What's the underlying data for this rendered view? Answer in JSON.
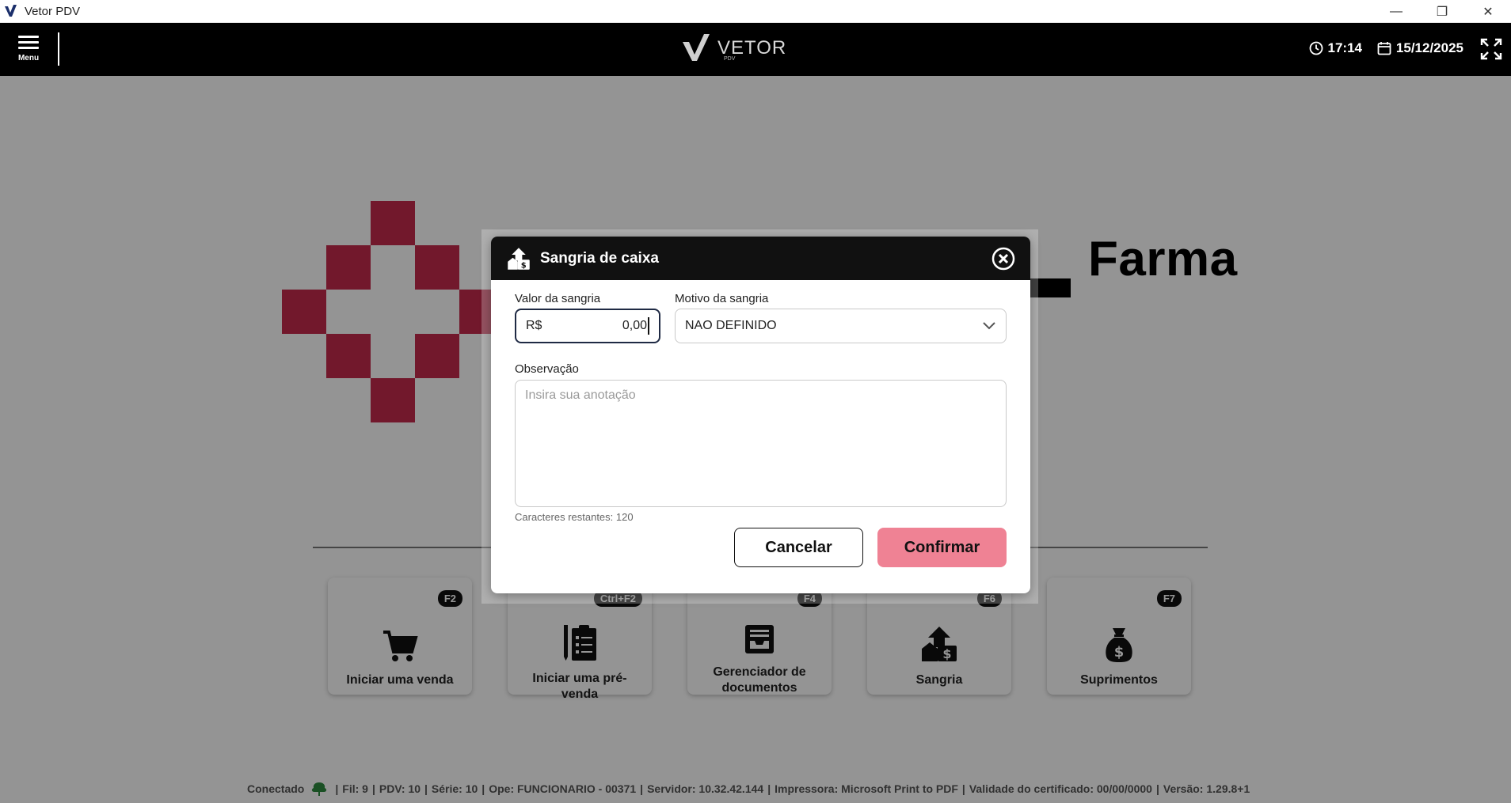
{
  "window": {
    "title": "Vetor PDV",
    "minimize_label": "—",
    "restore_label": "❐",
    "close_label": "✕"
  },
  "header": {
    "menu_label": "Menu",
    "brand_name": "VETOR",
    "brand_sub": "PDV",
    "time": "17:14",
    "date": "15/12/2025"
  },
  "background": {
    "brand_text": "Farma",
    "brand_color": "#c42a4d"
  },
  "cards": [
    {
      "label": "Iniciar uma venda",
      "shortcut": "F2",
      "icon": "cart-icon"
    },
    {
      "label": "Iniciar uma pré-venda",
      "shortcut": "Ctrl+F2",
      "icon": "clipboard-list-icon"
    },
    {
      "label": "Gerenciador de documentos",
      "shortcut": "F4",
      "icon": "document-tray-icon"
    },
    {
      "label": "Sangria",
      "shortcut": "F6",
      "icon": "cash-withdrawal-icon"
    },
    {
      "label": "Suprimentos",
      "shortcut": "F7",
      "icon": "money-bag-icon"
    }
  ],
  "status": {
    "connection": "Conectado",
    "fil": "Fil: 9",
    "pdv": "PDV: 10",
    "serie": "Série: 10",
    "ope": "Ope: FUNCIONARIO - 00371",
    "servidor": "Servidor: 10.32.42.144",
    "impressora": "Impressora: Microsoft Print to PDF",
    "certificado": "Validade do certificado: 00/00/0000",
    "versao": "Versão: 1.29.8+1"
  },
  "dialog": {
    "title": "Sangria de caixa",
    "valor_label": "Valor da sangria",
    "currency": "R$",
    "valor_value": "0,00",
    "motivo_label": "Motivo da sangria",
    "motivo_value": "NAO DEFINIDO",
    "obs_label": "Observação",
    "obs_placeholder": "Insira sua anotação",
    "counter_text": "Caracteres restantes: 120",
    "cancel_label": "Cancelar",
    "confirm_label": "Confirmar",
    "confirm_color": "#ef8294"
  }
}
